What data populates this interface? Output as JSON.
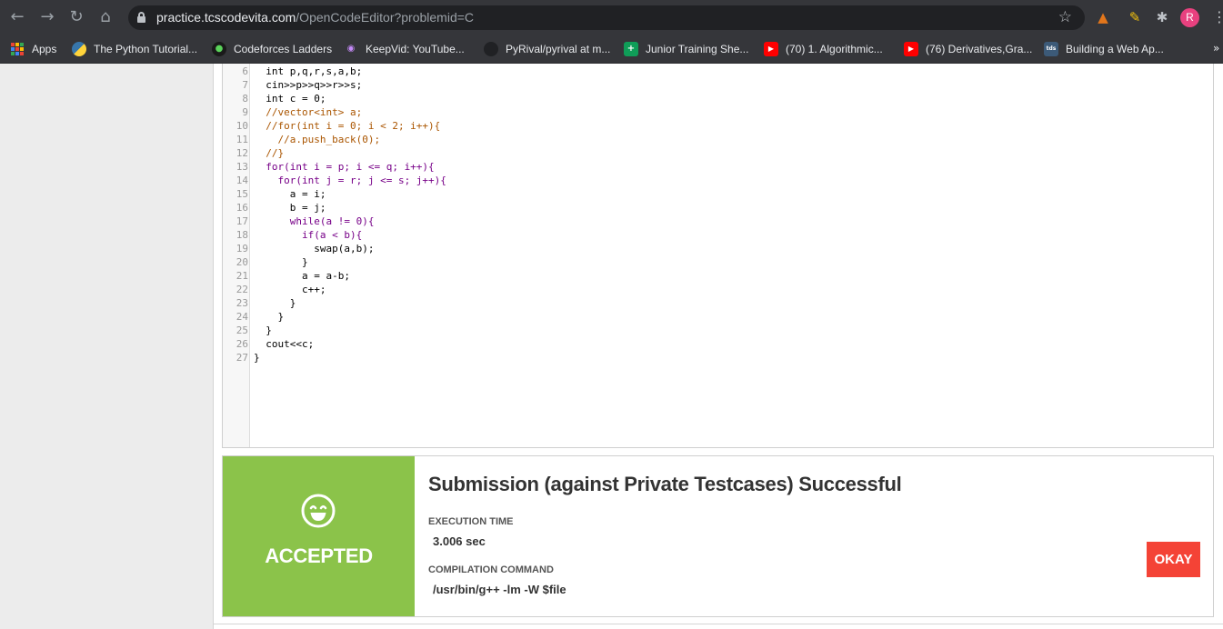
{
  "browser": {
    "url_host": "practice.tcscodevita.com",
    "url_path": "/OpenCodeEditor?problemid=C",
    "avatar_letter": "R"
  },
  "bookmarks": [
    {
      "label": "Apps",
      "icon": "apps-grid-icon"
    },
    {
      "label": "The Python Tutorial...",
      "icon": "python-icon"
    },
    {
      "label": "Codeforces Ladders",
      "icon": "alien-icon"
    },
    {
      "label": "KeepVid: YouTube...",
      "icon": "keepvid-icon"
    },
    {
      "label": "PyRival/pyrival at m...",
      "icon": "github-icon"
    },
    {
      "label": "Junior Training She...",
      "icon": "sheets-icon"
    },
    {
      "label": "(70) 1. Algorithmic...",
      "icon": "youtube-icon"
    },
    {
      "label": "(76) Derivatives,Gra...",
      "icon": "youtube-icon"
    },
    {
      "label": "Building a Web Ap...",
      "icon": "tds-icon"
    }
  ],
  "editor": {
    "lines": [
      {
        "n": "6",
        "text": "  int p,q,r,s,a,b;"
      },
      {
        "n": "7",
        "text": "  cin>>p>>q>>r>>s;"
      },
      {
        "n": "8",
        "text": "  int c = 0;"
      },
      {
        "n": "9",
        "text": "  //vector<int> a;"
      },
      {
        "n": "10",
        "text": "  //for(int i = 0; i < 2; i++){"
      },
      {
        "n": "11",
        "text": "    //a.push_back(0);"
      },
      {
        "n": "12",
        "text": "  //}"
      },
      {
        "n": "13",
        "text": "  for(int i = p; i <= q; i++){"
      },
      {
        "n": "14",
        "text": "    for(int j = r; j <= s; j++){"
      },
      {
        "n": "15",
        "text": "      a = i;"
      },
      {
        "n": "16",
        "text": "      b = j;"
      },
      {
        "n": "17",
        "text": "      while(a != 0){"
      },
      {
        "n": "18",
        "text": "        if(a < b){"
      },
      {
        "n": "19",
        "text": "          swap(a,b);"
      },
      {
        "n": "20",
        "text": "        }"
      },
      {
        "n": "21",
        "text": "        a = a-b;"
      },
      {
        "n": "22",
        "text": "        c++;"
      },
      {
        "n": "23",
        "text": "      }"
      },
      {
        "n": "24",
        "text": "    }"
      },
      {
        "n": "25",
        "text": "  }"
      },
      {
        "n": "26",
        "text": "  cout<<c;"
      },
      {
        "n": "27",
        "text": "}"
      }
    ]
  },
  "result": {
    "status": "ACCEPTED",
    "title": "Submission (against Private Testcases) Successful",
    "execution_time_label": "EXECUTION TIME",
    "execution_time_value": "3.006 sec",
    "compilation_label": "COMPILATION COMMAND",
    "compilation_value": "/usr/bin/g++ -lm -W $file",
    "okay_label": "OKAY"
  },
  "colors": {
    "accepted_green": "#8bc34a",
    "okay_red": "#f44336"
  }
}
